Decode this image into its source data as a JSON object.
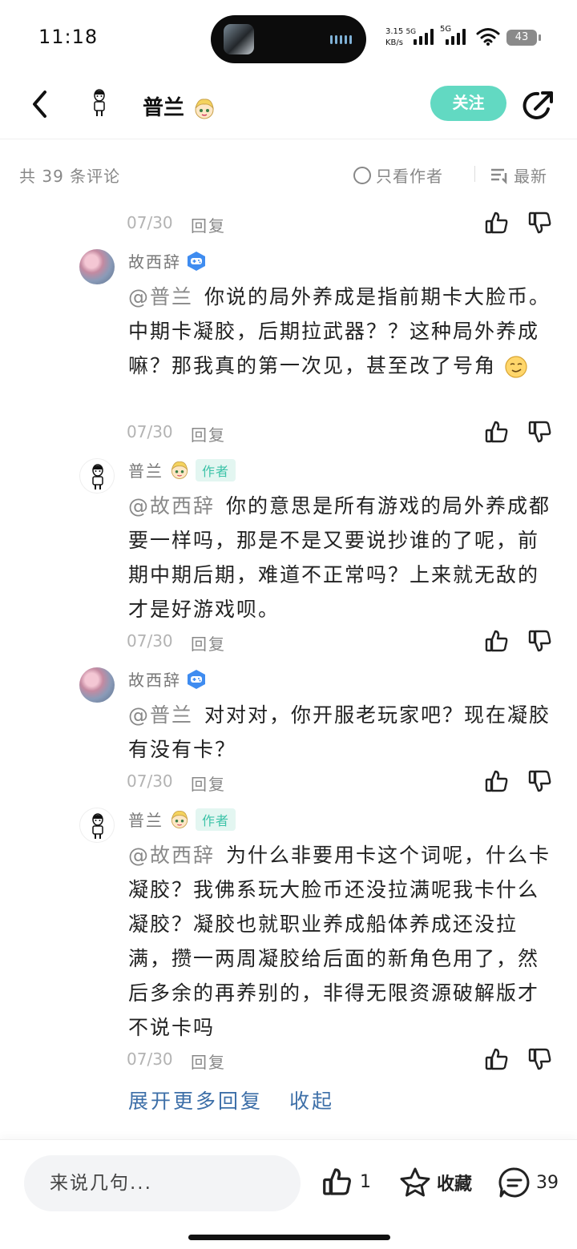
{
  "status_bar": {
    "time": "11:18",
    "net_speed_value": "3.15",
    "net_speed_unit": "KB/s",
    "signal1_label": "5G",
    "signal2_label": "5G",
    "battery": "43"
  },
  "header": {
    "title": "普兰",
    "follow_label": "关注"
  },
  "comments_bar": {
    "count_label": "共 39 条评论",
    "author_only_label": "只看作者",
    "sort_label": "最新"
  },
  "top_meta": {
    "date": "07/30",
    "reply_label": "回复"
  },
  "replies": [
    {
      "name": "故西辞",
      "mention": "@普兰",
      "text": "你说的局外养成是指前期卡大脸币。中期卡凝胶，后期拉武器？？这种局外养成嘛？那我真的第一次见，甚至改了号角",
      "date": "07/30",
      "reply_label": "回复"
    },
    {
      "name": "普兰",
      "tag": "作者",
      "mention": "@故西辞",
      "text": "你的意思是所有游戏的局外养成都要一样吗，那是不是又要说抄谁的了呢，前期中期后期，难道不正常吗？上来就无敌的才是好游戏呗。",
      "date": "07/30",
      "reply_label": "回复"
    },
    {
      "name": "故西辞",
      "mention": "@普兰",
      "text": "对对对，你开服老玩家吧？现在凝胶有没有卡？",
      "date": "07/30",
      "reply_label": "回复"
    },
    {
      "name": "普兰",
      "tag": "作者",
      "mention": "@故西辞",
      "text": "为什么非要用卡这个词呢，什么卡凝胶？我佛系玩大脸币还没拉满呢我卡什么凝胶？凝胶也就职业养成船体养成还没拉满，攒一两周凝胶给后面的新角色用了，然后多余的再养别的，非得无限资源破解版才不说卡吗",
      "date": "07/30",
      "reply_label": "回复"
    }
  ],
  "expand": {
    "more_label": "展开更多回复",
    "collapse_label": "收起"
  },
  "bottom_bar": {
    "input_placeholder": "来说几句...",
    "like_count": "1",
    "fav_label": "收藏",
    "comment_count": "39"
  },
  "colors": {
    "accent": "#62d9c2",
    "link": "#3d6fa8",
    "muted": "#888888"
  }
}
